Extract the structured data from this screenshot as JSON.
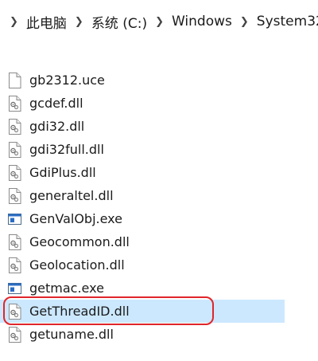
{
  "breadcrumb": {
    "items": [
      "此电脑",
      "系统 (C:)",
      "Windows",
      "System32"
    ]
  },
  "files": [
    {
      "name": "gb2312.uce",
      "icon": "blank-file-icon",
      "selected": false
    },
    {
      "name": "gcdef.dll",
      "icon": "dll-file-icon",
      "selected": false
    },
    {
      "name": "gdi32.dll",
      "icon": "dll-file-icon",
      "selected": false
    },
    {
      "name": "gdi32full.dll",
      "icon": "dll-file-icon",
      "selected": false
    },
    {
      "name": "GdiPlus.dll",
      "icon": "dll-file-icon",
      "selected": false
    },
    {
      "name": "generaltel.dll",
      "icon": "dll-file-icon",
      "selected": false
    },
    {
      "name": "GenValObj.exe",
      "icon": "exe-file-icon",
      "selected": false
    },
    {
      "name": "Geocommon.dll",
      "icon": "dll-file-icon",
      "selected": false
    },
    {
      "name": "Geolocation.dll",
      "icon": "dll-file-icon",
      "selected": false
    },
    {
      "name": "getmac.exe",
      "icon": "exe-file-icon",
      "selected": false
    },
    {
      "name": "GetThreadID.dll",
      "icon": "dll-file-icon",
      "selected": true
    },
    {
      "name": "getuname.dll",
      "icon": "dll-file-icon",
      "selected": false
    }
  ],
  "colors": {
    "selection": "#cce8ff",
    "annotation": "#e0262b"
  }
}
